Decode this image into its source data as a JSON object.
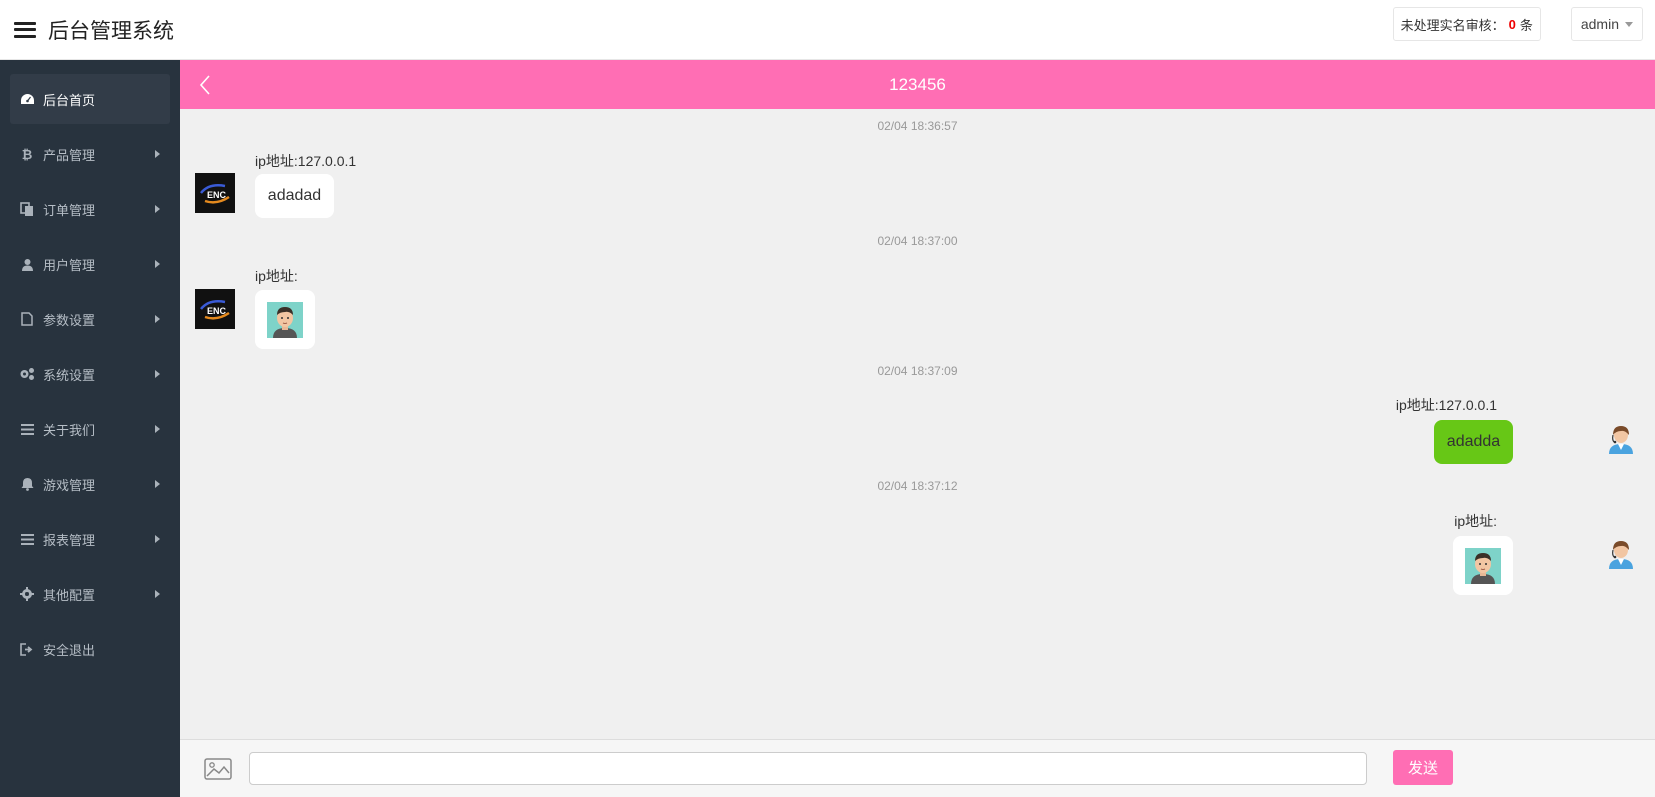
{
  "header": {
    "title": "后台管理系统",
    "pending_label": "未处理实名审核：",
    "pending_count": "0",
    "pending_unit": "条",
    "user": "admin"
  },
  "sidebar": {
    "items": [
      {
        "label": "后台首页",
        "icon": "dashboard-icon"
      },
      {
        "label": "产品管理",
        "icon": "bitcoin-icon"
      },
      {
        "label": "订单管理",
        "icon": "copy-icon"
      },
      {
        "label": "用户管理",
        "icon": "user-icon"
      },
      {
        "label": "参数设置",
        "icon": "file-icon"
      },
      {
        "label": "系统设置",
        "icon": "gears-icon"
      },
      {
        "label": "关于我们",
        "icon": "list-icon"
      },
      {
        "label": "游戏管理",
        "icon": "bell-icon"
      },
      {
        "label": "报表管理",
        "icon": "list-icon"
      },
      {
        "label": "其他配置",
        "icon": "gear-icon"
      },
      {
        "label": "安全退出",
        "icon": "sign-out-icon"
      }
    ]
  },
  "chat": {
    "title": "123456",
    "messages": [
      {
        "time": "02/04 18:36:57",
        "side": "left",
        "ip": "ip地址:127.0.0.1",
        "text": "adadad"
      },
      {
        "time": "02/04 18:37:00",
        "side": "left",
        "ip": "ip地址:",
        "text": ""
      },
      {
        "time": "02/04 18:37:09",
        "side": "right",
        "ip": "ip地址:127.0.0.1",
        "text": "adadda"
      },
      {
        "time": "02/04 18:37:12",
        "side": "right",
        "ip": "ip地址:",
        "text": ""
      }
    ],
    "input_value": "",
    "send_label": "发送"
  },
  "colors": {
    "accent": "#ff6eb4",
    "sidebar_bg": "#28333e",
    "sent_bubble": "#67c716",
    "pending_count": "#ee0000"
  }
}
